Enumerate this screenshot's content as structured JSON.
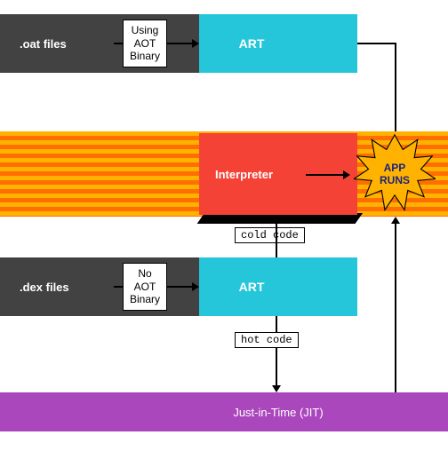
{
  "top": {
    "left_label": ".oat files",
    "mid_label": "Using\nAOT\nBinary",
    "right_label": "ART"
  },
  "middle": {
    "interpreter_label": "Interpreter",
    "star_label": "APP\nRUNS",
    "cold_label": "cold code"
  },
  "bottom": {
    "left_label": ".dex files",
    "mid_label": "No\nAOT\nBinary",
    "right_label": "ART",
    "hot_label": "hot code",
    "jit_label": "Just-in-Time (JIT)"
  }
}
